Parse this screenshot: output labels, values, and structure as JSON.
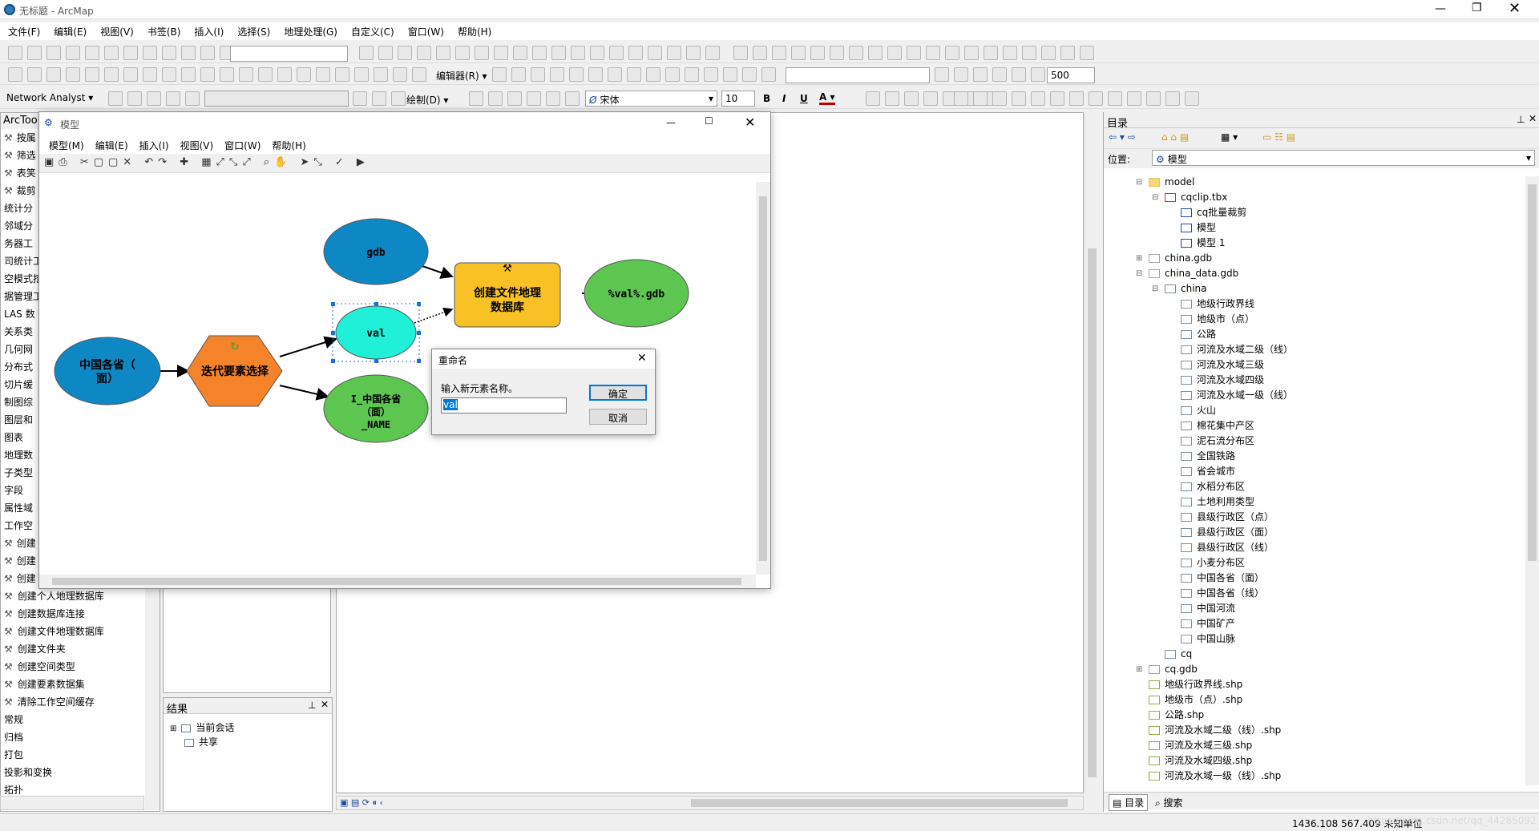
{
  "window": {
    "title": "无标题 - ArcMap"
  },
  "menubar": [
    "文件(F)",
    "编辑(E)",
    "视图(V)",
    "书签(B)",
    "插入(I)",
    "选择(S)",
    "地理处理(G)",
    "自定义(C)",
    "窗口(W)",
    "帮助(H)"
  ],
  "toolbar": {
    "editor_label": "编辑器(R)",
    "scale_value": "500",
    "network_label": "Network Analyst",
    "draw_label": "绘制(D)",
    "font_name": "宋体",
    "font_size": "10",
    "bold": "B",
    "italic": "I",
    "underline": "U",
    "text_color": "A"
  },
  "toolbox": {
    "title": "ArcToo",
    "items": [
      "按属",
      "筛选",
      "表笑",
      "裁剪",
      "统计分",
      "邻域分",
      "务器工",
      "司统计工",
      "空模式挖",
      "据管理工",
      "LAS 数",
      "关系类",
      "几何网",
      "分布式",
      "切片缓",
      "制图综",
      "图层和",
      "图表",
      "地理数",
      "子类型",
      "字段",
      "属性域",
      "工作空",
      "创建",
      "创建",
      "创建"
    ],
    "workspace_items": [
      "创建个人地理数据库",
      "创建数据库连接",
      "创建文件地理数据库",
      "创建文件夹",
      "创建空间类型",
      "创建要素数据集",
      "清除工作空间缓存"
    ],
    "tail_items": [
      "常规",
      "归档",
      "打包",
      "投影和变换",
      "拓扑"
    ]
  },
  "results": {
    "title": "结果",
    "items": [
      "当前会话",
      "共享"
    ]
  },
  "model_window": {
    "title": "模型",
    "menu": [
      "模型(M)",
      "编辑(E)",
      "插入(I)",
      "视图(V)",
      "窗口(W)",
      "帮助(H)"
    ],
    "nodes": {
      "gdb": "gdb",
      "create_fgdb": "创建文件地理数据库",
      "out_gdb": "%val%.gdb",
      "val": "val",
      "input": "中国各省（面）",
      "iterate": "迭代要素选择",
      "output_fc": "I_中国各省（面）_NAME"
    }
  },
  "rename_dialog": {
    "title": "重命名",
    "prompt": "输入新元素名称。",
    "value": "val",
    "ok": "确定",
    "cancel": "取消"
  },
  "catalog": {
    "title": "目录",
    "location_label": "位置:",
    "location_value": "模型",
    "tree": [
      {
        "label": "model",
        "indent": 1,
        "icon": "folder",
        "exp": "⊟"
      },
      {
        "label": "cqclip.tbx",
        "indent": 2,
        "icon": "toolbox",
        "exp": "⊟"
      },
      {
        "label": "cq批量裁剪",
        "indent": 3,
        "icon": "model"
      },
      {
        "label": "模型",
        "indent": 3,
        "icon": "model"
      },
      {
        "label": "模型 1",
        "indent": 3,
        "icon": "model"
      },
      {
        "label": "china.gdb",
        "indent": 1,
        "icon": "gdb",
        "exp": "⊞"
      },
      {
        "label": "china_data.gdb",
        "indent": 1,
        "icon": "gdb",
        "exp": "⊟"
      },
      {
        "label": "china",
        "indent": 2,
        "icon": "dataset",
        "exp": "⊟"
      },
      {
        "label": "地级行政界线",
        "indent": 3,
        "icon": "fc"
      },
      {
        "label": "地级市（点）",
        "indent": 3,
        "icon": "fc"
      },
      {
        "label": "公路",
        "indent": 3,
        "icon": "fc"
      },
      {
        "label": "河流及水域二级（线）",
        "indent": 3,
        "icon": "fc"
      },
      {
        "label": "河流及水域三级",
        "indent": 3,
        "icon": "fc"
      },
      {
        "label": "河流及水域四级",
        "indent": 3,
        "icon": "fc"
      },
      {
        "label": "河流及水域一级（线）",
        "indent": 3,
        "icon": "fc"
      },
      {
        "label": "火山",
        "indent": 3,
        "icon": "fc"
      },
      {
        "label": "棉花集中产区",
        "indent": 3,
        "icon": "fc"
      },
      {
        "label": "泥石流分布区",
        "indent": 3,
        "icon": "fc"
      },
      {
        "label": "全国铁路",
        "indent": 3,
        "icon": "fc"
      },
      {
        "label": "省会城市",
        "indent": 3,
        "icon": "fc"
      },
      {
        "label": "水稻分布区",
        "indent": 3,
        "icon": "fc"
      },
      {
        "label": "土地利用类型",
        "indent": 3,
        "icon": "fc"
      },
      {
        "label": "县级行政区（点）",
        "indent": 3,
        "icon": "fc"
      },
      {
        "label": "县级行政区（面）",
        "indent": 3,
        "icon": "fc"
      },
      {
        "label": "县级行政区（线）",
        "indent": 3,
        "icon": "fc"
      },
      {
        "label": "小麦分布区",
        "indent": 3,
        "icon": "fc"
      },
      {
        "label": "中国各省（面）",
        "indent": 3,
        "icon": "fc"
      },
      {
        "label": "中国各省（线）",
        "indent": 3,
        "icon": "fc"
      },
      {
        "label": "中国河流",
        "indent": 3,
        "icon": "fc"
      },
      {
        "label": "中国矿产",
        "indent": 3,
        "icon": "fc"
      },
      {
        "label": "中国山脉",
        "indent": 3,
        "icon": "fc"
      },
      {
        "label": "cq",
        "indent": 2,
        "icon": "fc"
      },
      {
        "label": "cq.gdb",
        "indent": 1,
        "icon": "gdb",
        "exp": "⊞"
      },
      {
        "label": "地级行政界线.shp",
        "indent": 1,
        "icon": "shp"
      },
      {
        "label": "地级市（点）.shp",
        "indent": 1,
        "icon": "shp"
      },
      {
        "label": "公路.shp",
        "indent": 1,
        "icon": "shp"
      },
      {
        "label": "河流及水域二级（线）.shp",
        "indent": 1,
        "icon": "shp"
      },
      {
        "label": "河流及水域三级.shp",
        "indent": 1,
        "icon": "shp"
      },
      {
        "label": "河流及水域四级.shp",
        "indent": 1,
        "icon": "shp"
      },
      {
        "label": "河流及水域一级（线）.shp",
        "indent": 1,
        "icon": "shp"
      }
    ],
    "tabs": [
      "目录",
      "搜索"
    ]
  },
  "status": {
    "coords": "1436.108  567.409 未知单位",
    "watermark": "https://blog.csdn.net/qq_44285092"
  }
}
